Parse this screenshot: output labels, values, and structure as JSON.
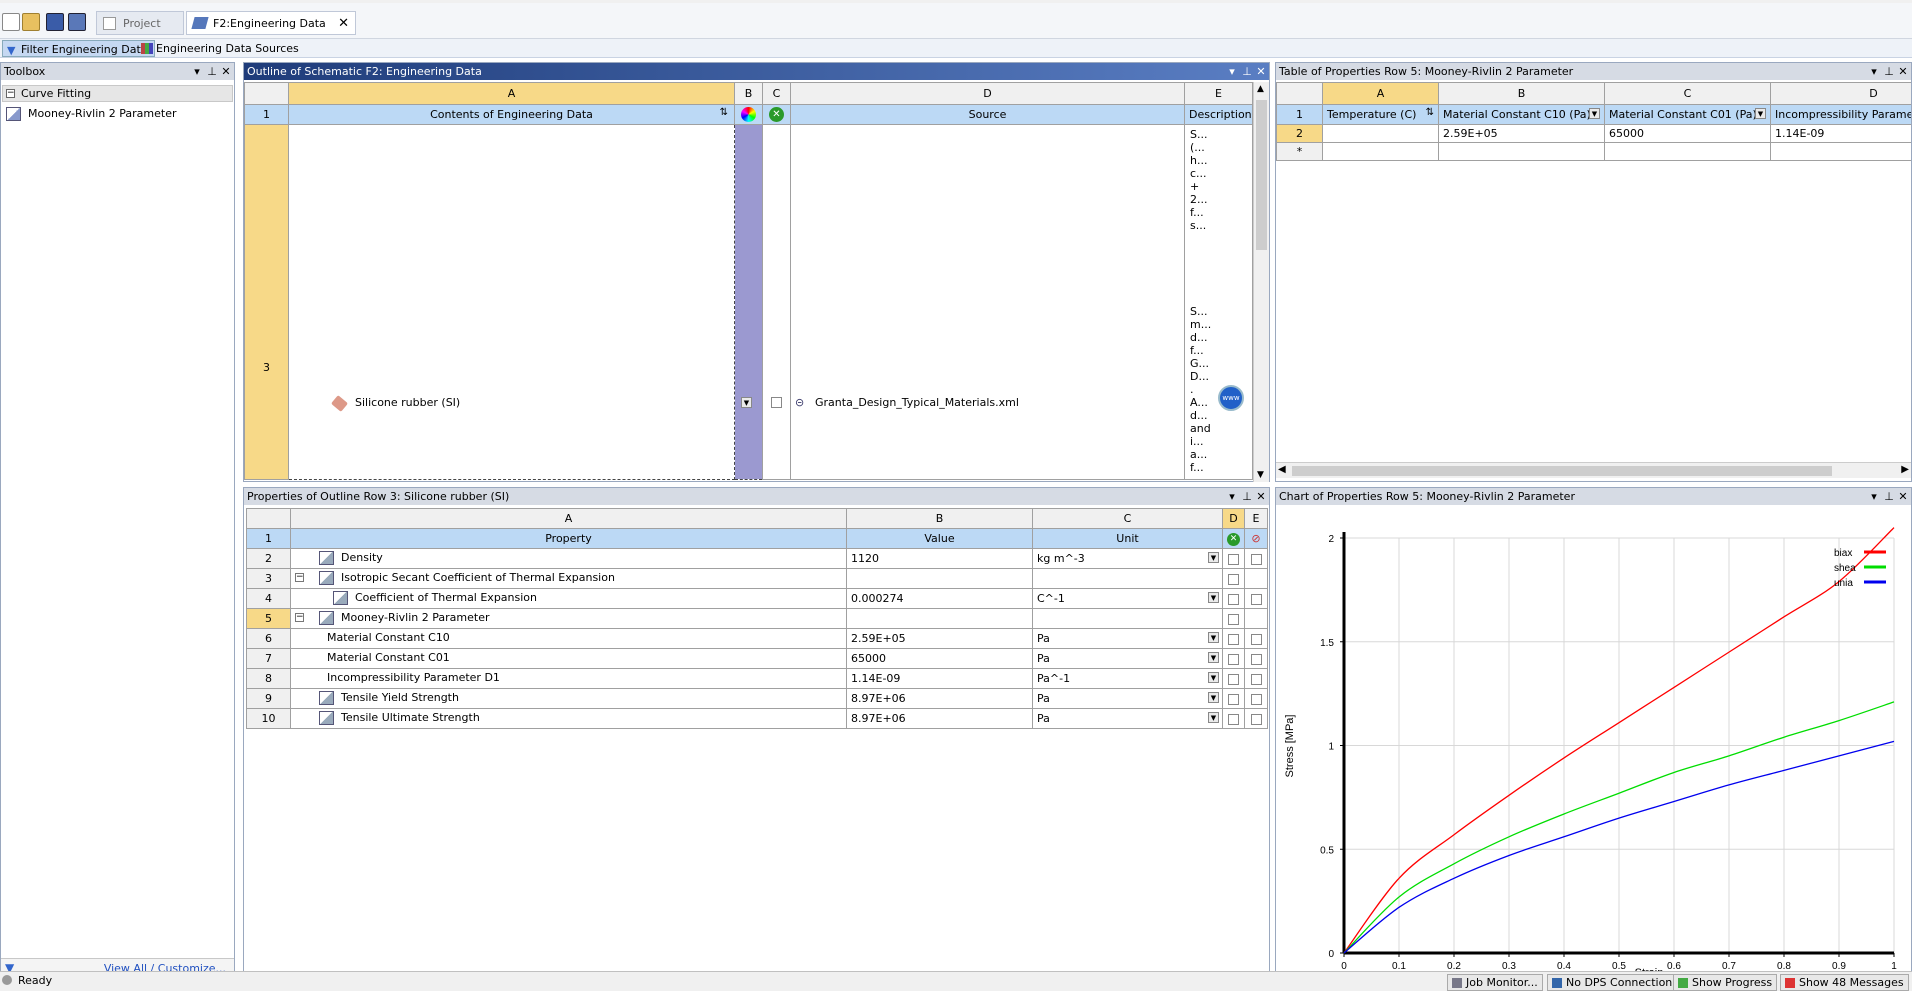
{
  "toolbar": {
    "tabs": [
      {
        "label": "Project"
      },
      {
        "label": "F2:Engineering Data"
      }
    ]
  },
  "ribbon": {
    "filter_label": "Filter Engineering Data",
    "sources_label": "Engineering Data Sources"
  },
  "toolbox": {
    "title": "Toolbox",
    "group": "Curve Fitting",
    "item": "Mooney-Rivlin 2 Parameter",
    "view_all": "View All / Customize..."
  },
  "outline": {
    "title": "Outline of Schematic F2: Engineering Data",
    "col_letters": [
      "A",
      "B",
      "C",
      "D",
      "E"
    ],
    "header": {
      "contents": "Contents of Engineering Data",
      "source": "Source",
      "description": "Description"
    },
    "row_numbers": [
      "1",
      "3"
    ],
    "material": "Silicone rubber (SI)",
    "source_file": "Granta_Design_Typical_Materials.xml",
    "desc_lines": [
      "S...",
      "(...",
      "h...",
      "c...",
      "+",
      "2...",
      "f...",
      "s...",
      "S...",
      "m...",
      "d...",
      "f...",
      "G...",
      "D...",
      ".",
      "A...",
      "d...",
      "and",
      "i...",
      "a...",
      "f..."
    ]
  },
  "table": {
    "title": "Table of Properties Row 5: Mooney-Rivlin 2 Parameter",
    "col_letters": [
      "A",
      "B",
      "C",
      "D"
    ],
    "headers": [
      "Temperature (C)",
      "Material Constant C10 (Pa)",
      "Material Constant C01 (Pa)",
      "Incompressibility Parameter"
    ],
    "row_numbers": [
      "1",
      "2",
      "*"
    ],
    "row2": [
      "",
      "2.59E+05",
      "65000",
      "1.14E-09"
    ]
  },
  "properties": {
    "title": "Properties of Outline Row 3: Silicone rubber (SI)",
    "col_letters": [
      "A",
      "B",
      "C",
      "D",
      "E"
    ],
    "headers": {
      "property": "Property",
      "value": "Value",
      "unit": "Unit"
    },
    "rows": [
      {
        "n": "2",
        "name": "Density",
        "value": "1120",
        "unit": "kg m^-3"
      },
      {
        "n": "3",
        "name": "Isotropic Secant Coefficient of Thermal Expansion",
        "value": "",
        "unit": ""
      },
      {
        "n": "4",
        "name": "Coefficient of Thermal Expansion",
        "value": "0.000274",
        "unit": "C^-1"
      },
      {
        "n": "5",
        "name": "Mooney-Rivlin 2 Parameter",
        "value": "",
        "unit": ""
      },
      {
        "n": "6",
        "name": "Material Constant C10",
        "value": "2.59E+05",
        "unit": "Pa"
      },
      {
        "n": "7",
        "name": "Material Constant C01",
        "value": "65000",
        "unit": "Pa"
      },
      {
        "n": "8",
        "name": "Incompressibility Parameter D1",
        "value": "1.14E-09",
        "unit": "Pa^-1"
      },
      {
        "n": "9",
        "name": "Tensile Yield Strength",
        "value": "8.97E+06",
        "unit": "Pa"
      },
      {
        "n": "10",
        "name": "Tensile Ultimate Strength",
        "value": "8.97E+06",
        "unit": "Pa"
      }
    ]
  },
  "chart": {
    "title": "Chart of Properties Row 5: Mooney-Rivlin 2 Parameter"
  },
  "chart_data": {
    "type": "line",
    "xlabel": "Strain",
    "ylabel": "Stress  [MPa]",
    "xlim": [
      0,
      1
    ],
    "ylim": [
      0,
      2
    ],
    "xticks": [
      "0",
      "0.1",
      "0.2",
      "0.3",
      "0.4",
      "0.5",
      "0.6",
      "0.7",
      "0.8",
      "0.9",
      "1"
    ],
    "yticks": [
      "0",
      "0.5",
      "1",
      "1.5",
      "2"
    ],
    "grid": true,
    "legend_position": "top-right",
    "series": [
      {
        "name": "biax",
        "color": "#ff0000",
        "x": [
          0,
          0.1,
          0.2,
          0.3,
          0.4,
          0.5,
          0.6,
          0.7,
          0.8,
          0.9,
          1.0
        ],
        "y": [
          0,
          0.36,
          0.57,
          0.76,
          0.94,
          1.11,
          1.28,
          1.45,
          1.62,
          1.79,
          2.05
        ]
      },
      {
        "name": "shea",
        "color": "#00dd00",
        "x": [
          0,
          0.1,
          0.2,
          0.3,
          0.4,
          0.5,
          0.6,
          0.7,
          0.8,
          0.9,
          1.0
        ],
        "y": [
          0,
          0.27,
          0.43,
          0.56,
          0.67,
          0.77,
          0.87,
          0.95,
          1.04,
          1.12,
          1.21
        ]
      },
      {
        "name": "unia",
        "color": "#0000ee",
        "x": [
          0,
          0.1,
          0.2,
          0.3,
          0.4,
          0.5,
          0.6,
          0.7,
          0.8,
          0.9,
          1.0
        ],
        "y": [
          0,
          0.22,
          0.36,
          0.47,
          0.56,
          0.65,
          0.73,
          0.81,
          0.88,
          0.95,
          1.02
        ]
      }
    ]
  },
  "statusbar": {
    "status": "Ready",
    "buttons": [
      "Job Monitor...",
      "No DPS Connection",
      "Show Progress",
      "Show 48 Messages"
    ]
  },
  "colors": {
    "accent": "#1f3c7a",
    "selection": "#f7d988",
    "header_row": "#bcd9f5"
  }
}
